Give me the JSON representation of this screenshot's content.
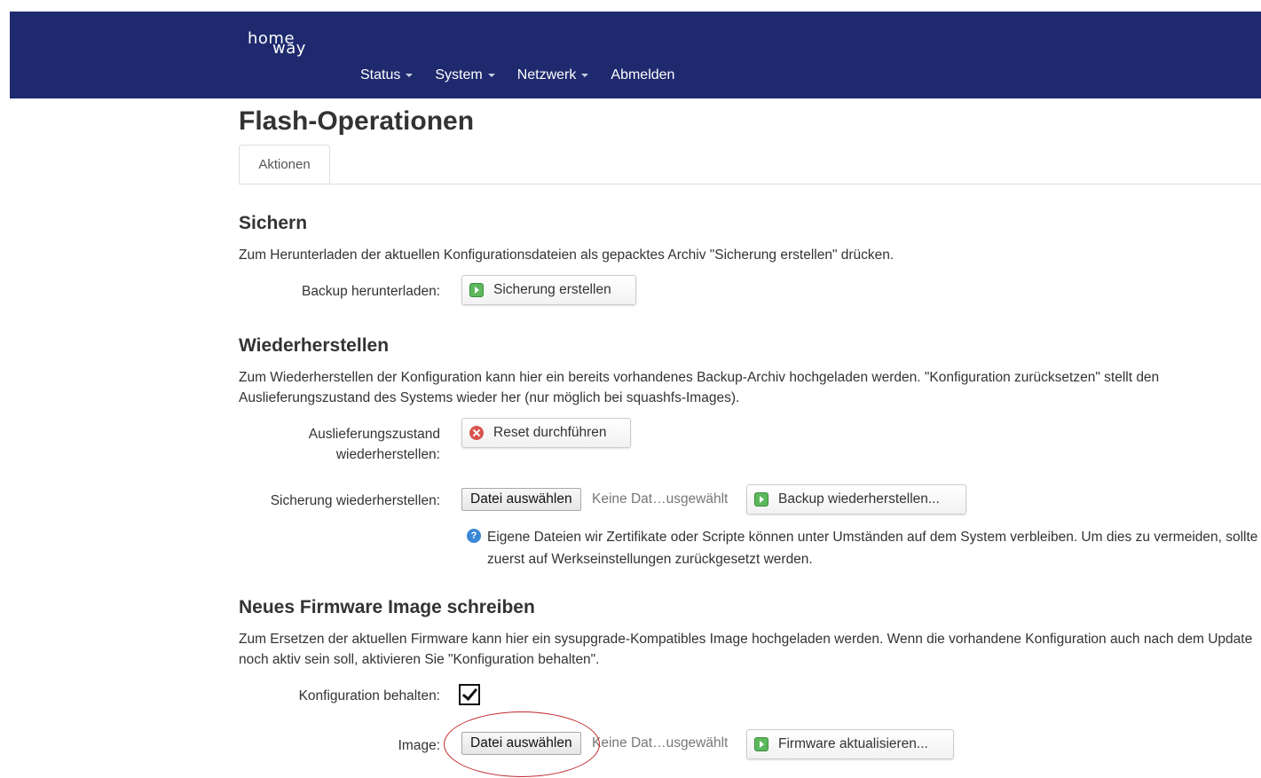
{
  "header": {
    "logo_line1": "home",
    "logo_line2": "way",
    "nav": [
      {
        "label": "Status",
        "has_dropdown": true
      },
      {
        "label": "System",
        "has_dropdown": true
      },
      {
        "label": "Netzwerk",
        "has_dropdown": true
      },
      {
        "label": "Abmelden",
        "has_dropdown": false
      }
    ],
    "background_color": "#1f2a6e"
  },
  "page": {
    "title": "Flash-Operationen",
    "tab": "Aktionen"
  },
  "backup": {
    "heading": "Sichern",
    "description": "Zum Herunterladen der aktuellen Konfigurationsdateien als gepacktes Archiv \"Sicherung erstellen\" drücken.",
    "label": "Backup herunterladen:",
    "button": "Sicherung erstellen",
    "button_icon": "green-play-icon"
  },
  "restore": {
    "heading": "Wiederherstellen",
    "description": "Zum Wiederherstellen der Konfiguration kann hier ein bereits vorhandenes Backup-Archiv hochgeladen werden. \"Konfiguration zurücksetzen\" stellt den Auslieferungszustand des Systems wieder her (nur möglich bei squashfs-Images).",
    "reset_label": "Auslieferungszustand wiederherstellen:",
    "reset_button": "Reset durchführen",
    "reset_icon": "red-x-icon",
    "restore_label": "Sicherung wiederherstellen:",
    "file_button": "Datei auswählen",
    "file_status": "Keine Dat…usgewählt",
    "restore_button": "Backup wiederherstellen...",
    "note": "Eigene Dateien wir Zertifikate oder Scripte können unter Umständen auf dem System verbleiben. Um dies zu vermeiden, sollte zuerst auf Werkseinstellungen zurückgesetzt werden."
  },
  "firmware": {
    "heading": "Neues Firmware Image schreiben",
    "description": "Zum Ersetzen der aktuellen Firmware kann hier ein sysupgrade-Kompatibles Image hochgeladen werden. Wenn die vorhandene Konfiguration auch nach dem Update noch aktiv sein soll, aktivieren Sie \"Konfiguration behalten\".",
    "keep_label": "Konfiguration behalten:",
    "keep_checked": true,
    "image_label": "Image:",
    "file_button": "Datei auswählen",
    "file_status": "Keine Dat…usgewählt",
    "upgrade_button": "Firmware aktualisieren..."
  },
  "annotation": {
    "color": "#c0282d",
    "shape": "ellipse"
  }
}
